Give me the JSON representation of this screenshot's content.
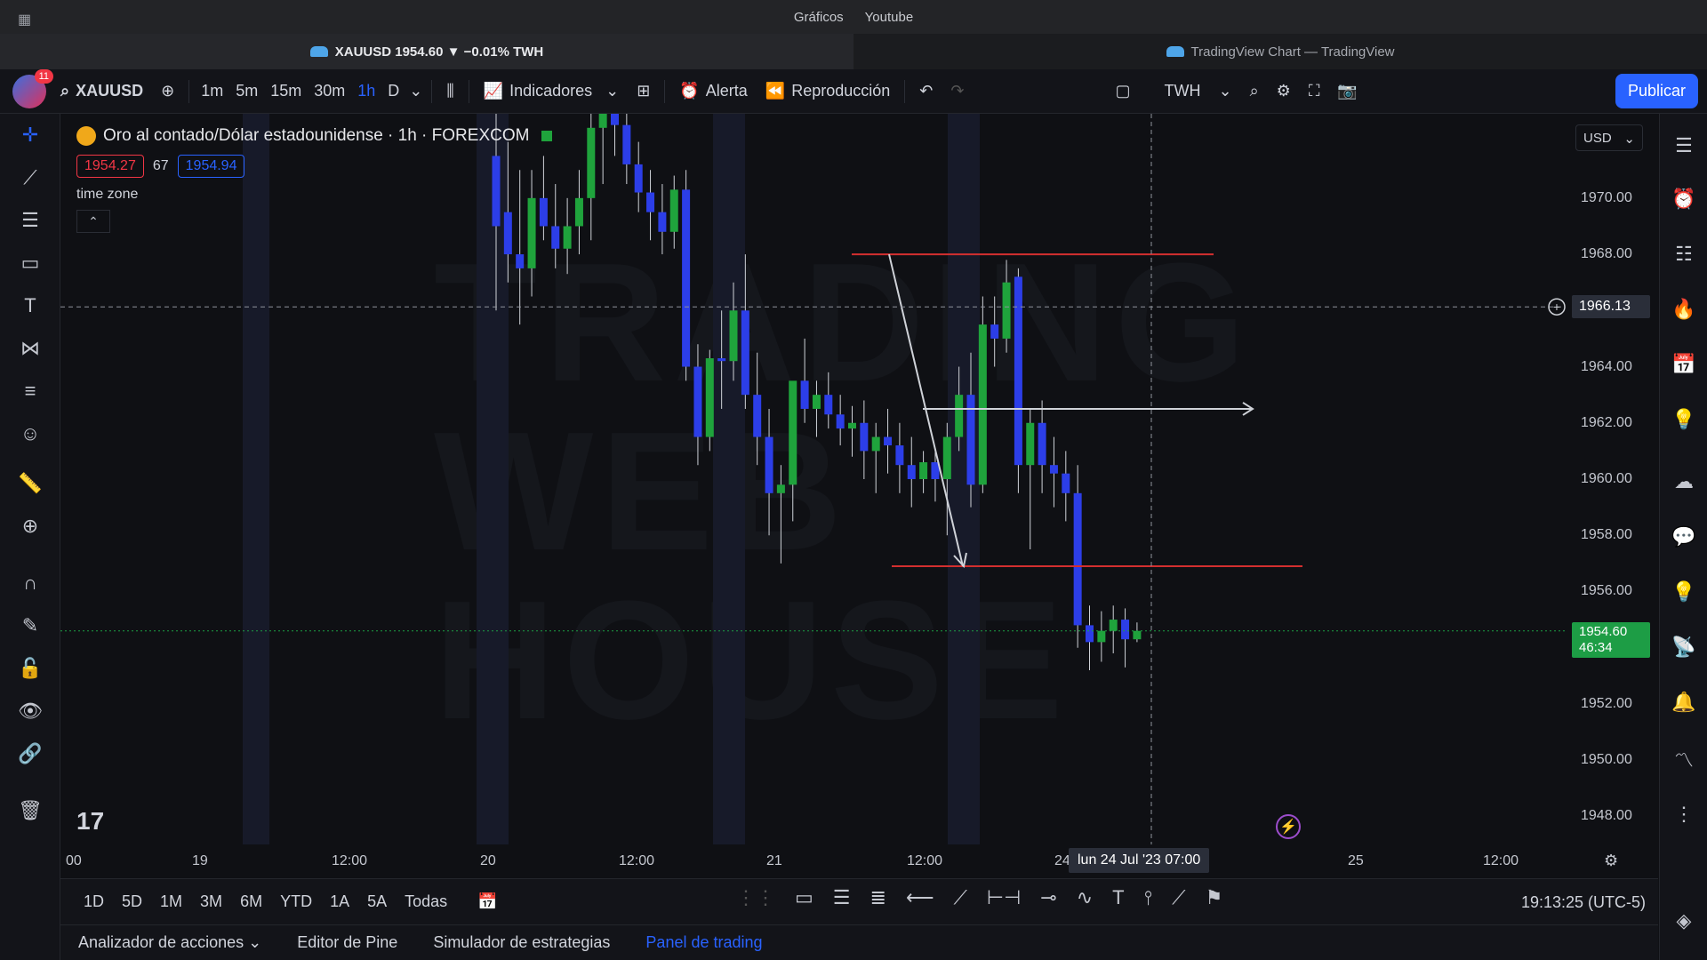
{
  "os_bar": {
    "menu_items": [
      "Gráficos",
      "Youtube"
    ]
  },
  "tabs": [
    {
      "label": "XAUUSD 1954.60 ▼ −0.01% TWH"
    },
    {
      "label": "TradingView Chart — TradingView"
    }
  ],
  "toolbar": {
    "notifications": "11",
    "symbol": "XAUUSD",
    "intervals": [
      "1m",
      "5m",
      "15m",
      "30m",
      "1h",
      "D"
    ],
    "selected_interval": "1h",
    "indicators_label": "Indicadores",
    "alert_label": "Alerta",
    "replay_label": "Reproducción",
    "layout_name": "TWH",
    "publish_label": "Publicar"
  },
  "legend": {
    "title": "Oro al contado/Dólar estadounidense · 1h · FOREXCOM",
    "sell_price": "1954.27",
    "spread": "67",
    "buy_price": "1954.94",
    "time_zone": "time zone"
  },
  "price_axis": {
    "currency": "USD",
    "ticks": [
      "1970.00",
      "1968.00",
      "1964.00",
      "1962.00",
      "1960.00",
      "1958.00",
      "1956.00",
      "1952.00",
      "1950.00",
      "1948.00"
    ],
    "crosshair_price": "1966.13",
    "current_price": "1954.60",
    "countdown": "46:34"
  },
  "time_axis": {
    "ticks": [
      "00",
      "19",
      "12:00",
      "20",
      "12:00",
      "21",
      "12:00",
      "24",
      "25",
      "12:00"
    ],
    "crosshair_time": "lun 24 Jul '23  07:00"
  },
  "range_bar": {
    "ranges": [
      "1D",
      "5D",
      "1M",
      "3M",
      "6M",
      "YTD",
      "1A",
      "5A",
      "Todas"
    ],
    "clock": "19:13:25 (UTC-5)"
  },
  "panel_tabs": [
    "Analizador de acciones",
    "Editor de Pine",
    "Simulador de estrategias",
    "Panel de trading"
  ],
  "colors": {
    "bull": "#1fa33c",
    "bear": "#2c3ee8",
    "accent": "#2962ff",
    "level_line": "#d32f2f",
    "current_price": "#1d9d45"
  },
  "chart_data": {
    "type": "candlestick",
    "title": "Oro al contado/Dólar estadounidense · 1h · FOREXCOM",
    "xlabel": "",
    "ylabel": "",
    "ylim": [
      1947,
      1973
    ],
    "levels": {
      "resistance": 1968.0,
      "support": 1956.9,
      "mid": 1962.5,
      "current": 1954.6
    },
    "candles": [
      {
        "o": 1971.5,
        "h": 1973.0,
        "l": 1966.0,
        "c": 1969.0
      },
      {
        "o": 1969.5,
        "h": 1972.0,
        "l": 1967.0,
        "c": 1968.0
      },
      {
        "o": 1968.0,
        "h": 1971.0,
        "l": 1965.5,
        "c": 1967.5
      },
      {
        "o": 1967.5,
        "h": 1971.0,
        "l": 1966.5,
        "c": 1970.0
      },
      {
        "o": 1970.0,
        "h": 1971.5,
        "l": 1968.5,
        "c": 1969.0
      },
      {
        "o": 1969.0,
        "h": 1970.5,
        "l": 1967.5,
        "c": 1968.2
      },
      {
        "o": 1968.2,
        "h": 1970.0,
        "l": 1967.3,
        "c": 1969.0
      },
      {
        "o": 1969.0,
        "h": 1971.0,
        "l": 1968.0,
        "c": 1970.0
      },
      {
        "o": 1970.0,
        "h": 1973.2,
        "l": 1968.5,
        "c": 1972.5
      },
      {
        "o": 1972.5,
        "h": 1973.8,
        "l": 1970.5,
        "c": 1973.2
      },
      {
        "o": 1973.2,
        "h": 1974.0,
        "l": 1971.5,
        "c": 1972.6
      },
      {
        "o": 1972.6,
        "h": 1973.5,
        "l": 1970.5,
        "c": 1971.2
      },
      {
        "o": 1971.2,
        "h": 1972.0,
        "l": 1969.5,
        "c": 1970.2
      },
      {
        "o": 1970.2,
        "h": 1971.0,
        "l": 1968.5,
        "c": 1969.5
      },
      {
        "o": 1969.5,
        "h": 1970.5,
        "l": 1968.0,
        "c": 1968.8
      },
      {
        "o": 1968.8,
        "h": 1970.8,
        "l": 1968.2,
        "c": 1970.3
      },
      {
        "o": 1970.3,
        "h": 1971.0,
        "l": 1963.5,
        "c": 1964.0
      },
      {
        "o": 1964.0,
        "h": 1964.8,
        "l": 1960.5,
        "c": 1961.5
      },
      {
        "o": 1961.5,
        "h": 1964.6,
        "l": 1961.0,
        "c": 1964.3
      },
      {
        "o": 1964.3,
        "h": 1966.0,
        "l": 1962.5,
        "c": 1964.2
      },
      {
        "o": 1964.2,
        "h": 1967.0,
        "l": 1963.5,
        "c": 1966.0
      },
      {
        "o": 1966.0,
        "h": 1968.0,
        "l": 1962.5,
        "c": 1963.0
      },
      {
        "o": 1963.0,
        "h": 1964.5,
        "l": 1960.5,
        "c": 1961.5
      },
      {
        "o": 1961.5,
        "h": 1962.5,
        "l": 1958.0,
        "c": 1959.5
      },
      {
        "o": 1959.5,
        "h": 1960.5,
        "l": 1957.0,
        "c": 1959.8
      },
      {
        "o": 1959.8,
        "h": 1961.5,
        "l": 1958.5,
        "c": 1963.5
      },
      {
        "o": 1963.5,
        "h": 1965.0,
        "l": 1962.0,
        "c": 1962.5
      },
      {
        "o": 1962.5,
        "h": 1963.5,
        "l": 1961.5,
        "c": 1963.0
      },
      {
        "o": 1963.0,
        "h": 1963.8,
        "l": 1961.8,
        "c": 1962.3
      },
      {
        "o": 1962.3,
        "h": 1963.0,
        "l": 1961.2,
        "c": 1961.8
      },
      {
        "o": 1961.8,
        "h": 1962.6,
        "l": 1960.8,
        "c": 1962.0
      },
      {
        "o": 1962.0,
        "h": 1962.8,
        "l": 1960.0,
        "c": 1961.0
      },
      {
        "o": 1961.0,
        "h": 1962.0,
        "l": 1959.5,
        "c": 1961.5
      },
      {
        "o": 1961.5,
        "h": 1962.5,
        "l": 1960.2,
        "c": 1961.2
      },
      {
        "o": 1961.2,
        "h": 1962.0,
        "l": 1959.5,
        "c": 1960.5
      },
      {
        "o": 1960.5,
        "h": 1961.5,
        "l": 1959.0,
        "c": 1960.0
      },
      {
        "o": 1960.0,
        "h": 1961.0,
        "l": 1959.5,
        "c": 1960.6
      },
      {
        "o": 1960.6,
        "h": 1961.0,
        "l": 1959.2,
        "c": 1960.0
      },
      {
        "o": 1960.0,
        "h": 1962.0,
        "l": 1958.0,
        "c": 1961.5
      },
      {
        "o": 1961.5,
        "h": 1964.0,
        "l": 1961.0,
        "c": 1963.0
      },
      {
        "o": 1963.0,
        "h": 1964.5,
        "l": 1959.0,
        "c": 1959.8
      },
      {
        "o": 1959.8,
        "h": 1966.5,
        "l": 1959.5,
        "c": 1965.5
      },
      {
        "o": 1965.5,
        "h": 1966.5,
        "l": 1964.0,
        "c": 1965.0
      },
      {
        "o": 1965.0,
        "h": 1967.8,
        "l": 1964.5,
        "c": 1967.0
      },
      {
        "o": 1967.2,
        "h": 1967.5,
        "l": 1959.5,
        "c": 1960.5
      },
      {
        "o": 1960.5,
        "h": 1962.5,
        "l": 1957.5,
        "c": 1962.0
      },
      {
        "o": 1962.0,
        "h": 1962.8,
        "l": 1959.5,
        "c": 1960.5
      },
      {
        "o": 1960.5,
        "h": 1961.5,
        "l": 1959.0,
        "c": 1960.2
      },
      {
        "o": 1960.2,
        "h": 1961.0,
        "l": 1958.5,
        "c": 1959.5
      },
      {
        "o": 1959.5,
        "h": 1960.5,
        "l": 1954.0,
        "c": 1954.8
      },
      {
        "o": 1954.8,
        "h": 1955.5,
        "l": 1953.2,
        "c": 1954.2
      },
      {
        "o": 1954.2,
        "h": 1955.3,
        "l": 1953.5,
        "c": 1954.6
      },
      {
        "o": 1954.6,
        "h": 1955.5,
        "l": 1953.8,
        "c": 1955.0
      },
      {
        "o": 1955.0,
        "h": 1955.4,
        "l": 1953.3,
        "c": 1954.3
      },
      {
        "o": 1954.3,
        "h": 1954.9,
        "l": 1954.2,
        "c": 1954.6
      }
    ]
  }
}
